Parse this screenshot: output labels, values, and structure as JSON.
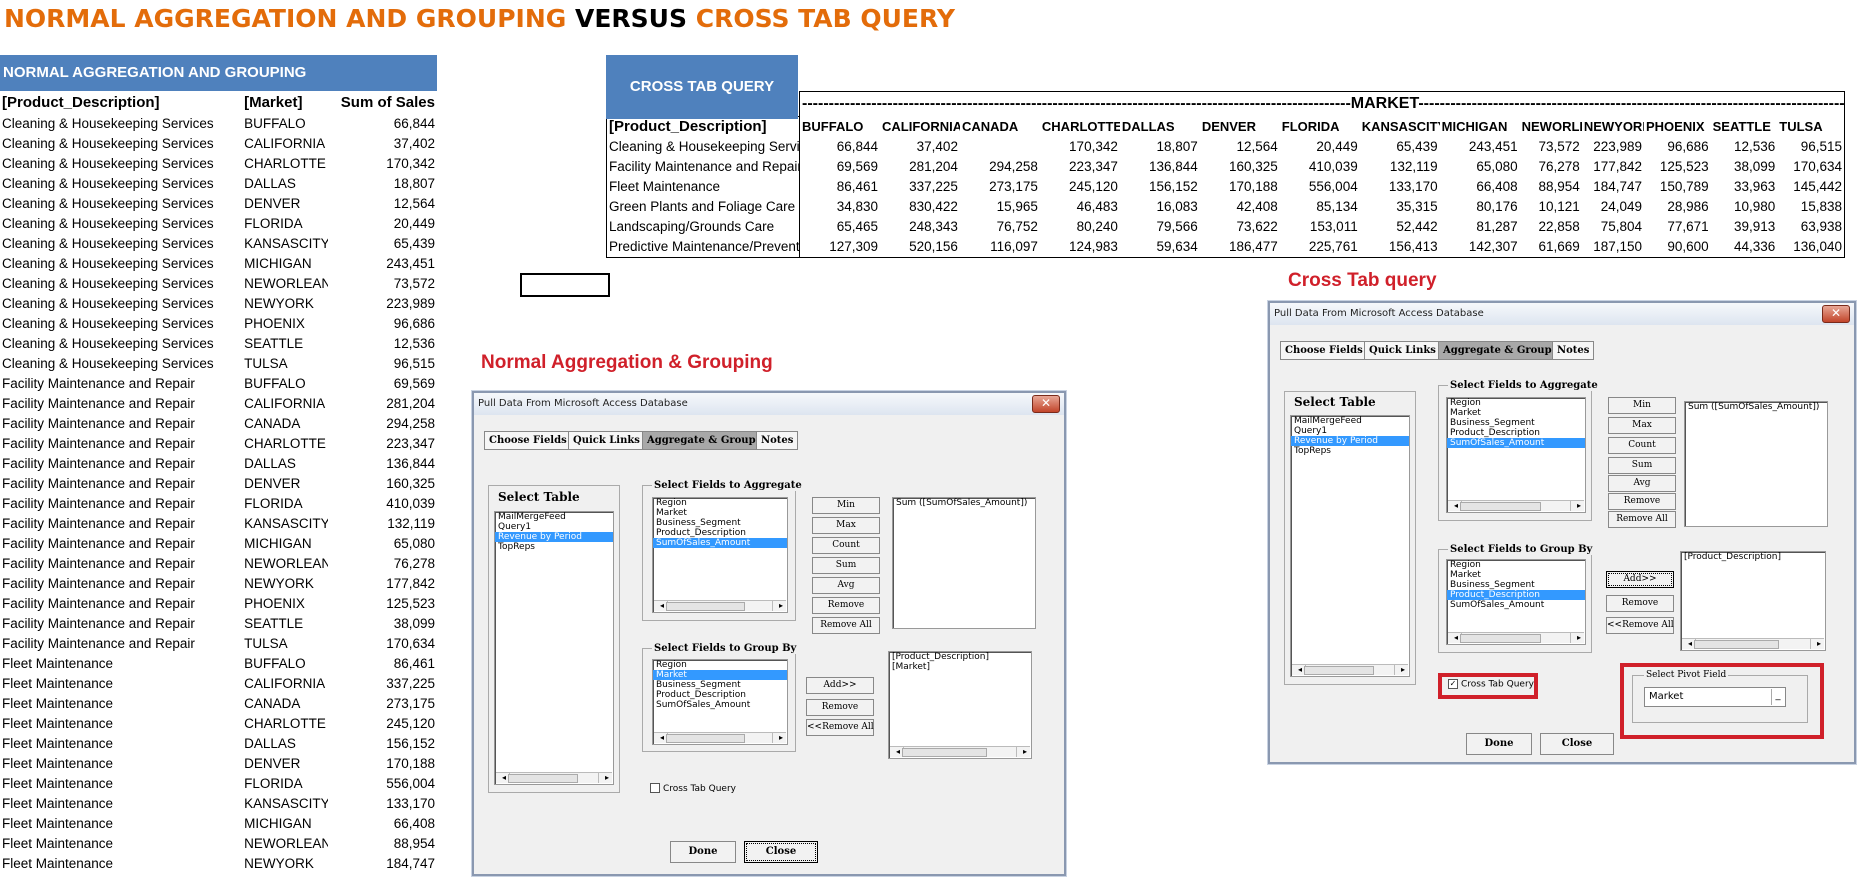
{
  "title": {
    "part1": "NORMAL AGGREGATION AND GROUPING",
    "part2": "VERSUS",
    "part3": "CROSS TAB QUERY"
  },
  "normal_table": {
    "header": "NORMAL AGGREGATION AND GROUPING",
    "columns": [
      "[Product_Description]",
      "[Market]",
      "Sum of Sales"
    ],
    "rows": [
      [
        "Cleaning & Housekeeping Services",
        "BUFFALO",
        "66,844"
      ],
      [
        "Cleaning & Housekeeping Services",
        "CALIFORNIA",
        "37,402"
      ],
      [
        "Cleaning & Housekeeping Services",
        "CHARLOTTE",
        "170,342"
      ],
      [
        "Cleaning & Housekeeping Services",
        "DALLAS",
        "18,807"
      ],
      [
        "Cleaning & Housekeeping Services",
        "DENVER",
        "12,564"
      ],
      [
        "Cleaning & Housekeeping Services",
        "FLORIDA",
        "20,449"
      ],
      [
        "Cleaning & Housekeeping Services",
        "KANSASCITY",
        "65,439"
      ],
      [
        "Cleaning & Housekeeping Services",
        "MICHIGAN",
        "243,451"
      ],
      [
        "Cleaning & Housekeeping Services",
        "NEWORLEANS",
        "73,572"
      ],
      [
        "Cleaning & Housekeeping Services",
        "NEWYORK",
        "223,989"
      ],
      [
        "Cleaning & Housekeeping Services",
        "PHOENIX",
        "96,686"
      ],
      [
        "Cleaning & Housekeeping Services",
        "SEATTLE",
        "12,536"
      ],
      [
        "Cleaning & Housekeeping Services",
        "TULSA",
        "96,515"
      ],
      [
        "Facility Maintenance and Repair",
        "BUFFALO",
        "69,569"
      ],
      [
        "Facility Maintenance and Repair",
        "CALIFORNIA",
        "281,204"
      ],
      [
        "Facility Maintenance and Repair",
        "CANADA",
        "294,258"
      ],
      [
        "Facility Maintenance and Repair",
        "CHARLOTTE",
        "223,347"
      ],
      [
        "Facility Maintenance and Repair",
        "DALLAS",
        "136,844"
      ],
      [
        "Facility Maintenance and Repair",
        "DENVER",
        "160,325"
      ],
      [
        "Facility Maintenance and Repair",
        "FLORIDA",
        "410,039"
      ],
      [
        "Facility Maintenance and Repair",
        "KANSASCITY",
        "132,119"
      ],
      [
        "Facility Maintenance and Repair",
        "MICHIGAN",
        "65,080"
      ],
      [
        "Facility Maintenance and Repair",
        "NEWORLEANS",
        "76,278"
      ],
      [
        "Facility Maintenance and Repair",
        "NEWYORK",
        "177,842"
      ],
      [
        "Facility Maintenance and Repair",
        "PHOENIX",
        "125,523"
      ],
      [
        "Facility Maintenance and Repair",
        "SEATTLE",
        "38,099"
      ],
      [
        "Facility Maintenance and Repair",
        "TULSA",
        "170,634"
      ],
      [
        "Fleet Maintenance",
        "BUFFALO",
        "86,461"
      ],
      [
        "Fleet Maintenance",
        "CALIFORNIA",
        "337,225"
      ],
      [
        "Fleet Maintenance",
        "CANADA",
        "273,175"
      ],
      [
        "Fleet Maintenance",
        "CHARLOTTE",
        "245,120"
      ],
      [
        "Fleet Maintenance",
        "DALLAS",
        "156,152"
      ],
      [
        "Fleet Maintenance",
        "DENVER",
        "170,188"
      ],
      [
        "Fleet Maintenance",
        "FLORIDA",
        "556,004"
      ],
      [
        "Fleet Maintenance",
        "KANSASCITY",
        "133,170"
      ],
      [
        "Fleet Maintenance",
        "MICHIGAN",
        "66,408"
      ],
      [
        "Fleet Maintenance",
        "NEWORLEANS",
        "88,954"
      ],
      [
        "Fleet Maintenance",
        "NEWYORK",
        "184,747"
      ]
    ]
  },
  "crosstab": {
    "title": "CROSS TAB QUERY",
    "market_label": "-------------------------------------------------------------------------------------------------------MARKET--------------------------------------------------------------------------------------------------------",
    "row_header": "[Product_Description]",
    "columns": [
      "BUFFALO",
      "CALIFORNIA",
      "CANADA",
      "CHARLOTTE",
      "DALLAS",
      "DENVER",
      "FLORIDA",
      "KANSASCITY",
      "MICHIGAN",
      "NEWORLEANS",
      "NEWYORK",
      "PHOENIX",
      "SEATTLE",
      "TULSA"
    ],
    "rows": [
      {
        "label": "Cleaning & Housekeeping Services",
        "values": [
          "66,844",
          "37,402",
          "",
          "170,342",
          "18,807",
          "12,564",
          "20,449",
          "65,439",
          "243,451",
          "73,572",
          "223,989",
          "96,686",
          "12,536",
          "96,515"
        ]
      },
      {
        "label": "Facility Maintenance and Repair",
        "values": [
          "69,569",
          "281,204",
          "294,258",
          "223,347",
          "136,844",
          "160,325",
          "410,039",
          "132,119",
          "65,080",
          "76,278",
          "177,842",
          "125,523",
          "38,099",
          "170,634"
        ]
      },
      {
        "label": "Fleet Maintenance",
        "values": [
          "86,461",
          "337,225",
          "273,175",
          "245,120",
          "156,152",
          "170,188",
          "556,004",
          "133,170",
          "66,408",
          "88,954",
          "184,747",
          "150,789",
          "33,963",
          "145,442"
        ]
      },
      {
        "label": "Green Plants and Foliage Care",
        "values": [
          "34,830",
          "830,422",
          "15,965",
          "46,483",
          "16,083",
          "42,408",
          "85,134",
          "35,315",
          "80,176",
          "10,121",
          "24,049",
          "28,986",
          "10,980",
          "15,838"
        ]
      },
      {
        "label": "Landscaping/Grounds Care",
        "values": [
          "65,465",
          "248,343",
          "76,752",
          "80,240",
          "79,566",
          "73,622",
          "153,011",
          "52,442",
          "81,287",
          "22,858",
          "75,804",
          "77,671",
          "39,913",
          "63,938"
        ]
      },
      {
        "label": "Predictive Maintenance/Preventive Maintenance",
        "values": [
          "127,309",
          "520,156",
          "116,097",
          "124,983",
          "59,634",
          "186,477",
          "225,761",
          "156,413",
          "142,307",
          "61,669",
          "187,150",
          "90,600",
          "44,336",
          "136,040"
        ]
      }
    ]
  },
  "labels": {
    "normal": "Normal Aggregation & Grouping",
    "crosstab": "Cross Tab query"
  },
  "dialog": {
    "title": "Pull Data From Microsoft Access Database",
    "close_glyph": "✕",
    "tabs": [
      "Choose Fields",
      "Quick Links",
      "Aggregate & Group",
      "Notes"
    ],
    "active_tab": "Aggregate & Group",
    "select_table_label": "Select Table",
    "tables": [
      "MailMergeFeed",
      "Query1",
      "Revenue by Period",
      "TopReps"
    ],
    "selected_table": "Revenue by Period",
    "aggregate_label": "Select Fields to Aggregate",
    "aggregate_fields": [
      "Region",
      "Market",
      "Business_Segment",
      "Product_Description",
      "SumOfSales_Amount"
    ],
    "aggregate_selected": "SumOfSales_Amount",
    "agg_buttons": [
      "Min",
      "Max",
      "Count",
      "Sum",
      "Avg",
      "Remove",
      "Remove All"
    ],
    "aggregate_result": "Sum ([SumOfSales_Amount])",
    "group_label": "Select Fields to Group By",
    "group_fields": [
      "Region",
      "Market",
      "Business_Segment",
      "Product_Description",
      "SumOfSales_Amount"
    ],
    "group_buttons": [
      "Add>>",
      "Remove",
      "<<Remove All"
    ],
    "crosstab_checkbox": "Cross Tab Query",
    "done": "Done",
    "close": "Close",
    "pivot_label": "Select Pivot Field",
    "pivot_value": "Market",
    "dropdown_glyph": "_",
    "scroll_left": "◂",
    "scroll_right": "▸",
    "check_glyph": "✓"
  },
  "dialog_normal": {
    "group_selected": "Market",
    "group_result": [
      "[Product_Description]",
      "[Market]"
    ],
    "crosstab_checked": false
  },
  "dialog_crosstab": {
    "group_selected": "Product_Description",
    "group_result": [
      "[Product_Description]"
    ],
    "crosstab_checked": true
  },
  "colors": {
    "title_orange": "#e36c0a",
    "header_blue": "#4f81bd",
    "label_red": "#d0202a",
    "selection_blue": "#3399ff"
  }
}
